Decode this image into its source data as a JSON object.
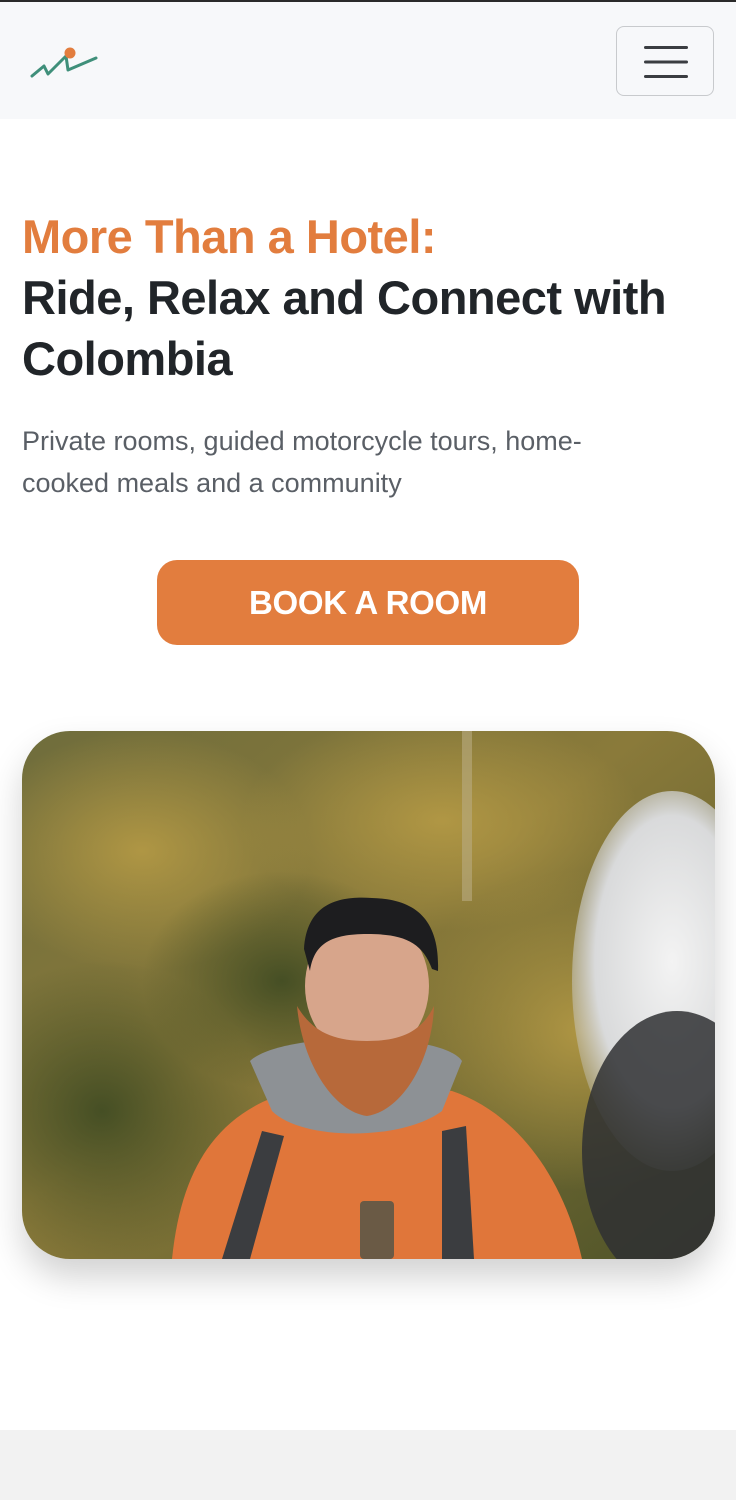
{
  "header": {
    "logo_icon": "mountain-logo-icon",
    "menu_icon": "hamburger-menu-icon"
  },
  "hero": {
    "title_accent": "More Than a Hotel:",
    "title_main": "Ride, Relax and Connect with Colombia",
    "subtitle": "Private rooms, guided motorcycle tours, home-cooked meals and a community",
    "cta_label": "BOOK A ROOM"
  },
  "colors": {
    "accent": "#e27d3e",
    "heading": "#212529",
    "body_text": "#5a5f66",
    "navbar_bg": "#f7f8fa",
    "footer_bg": "#f2f2f2",
    "logo_green": "#3f8f7a"
  }
}
